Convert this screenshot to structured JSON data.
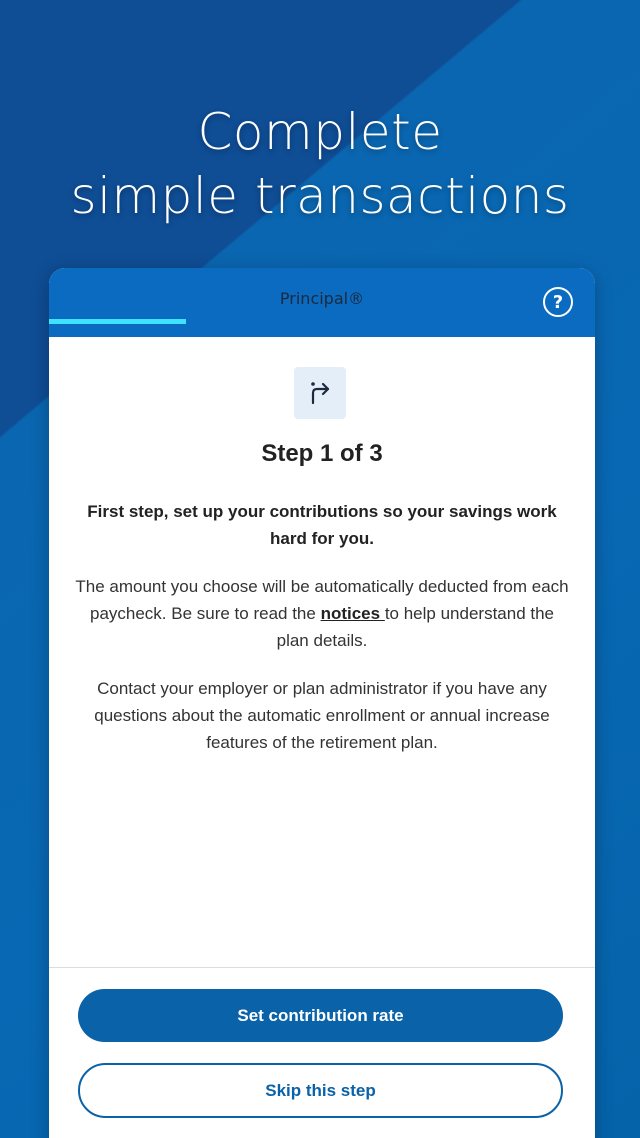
{
  "headline": {
    "line1": "Complete",
    "line2": "simple transactions"
  },
  "header": {
    "title": "Principal®",
    "help_icon": "help-circle-icon",
    "progress_fraction": 0.25
  },
  "step": {
    "icon": "turn-right-arrow-icon",
    "title": "Step 1 of 3",
    "lead": "First step, set up your contributions so your savings work hard for you.",
    "para1_before": "The amount you choose will be automatically deducted from each paycheck. Be sure to read the ",
    "para1_link": "notices ",
    "para1_after": "to help understand the plan details.",
    "para2": "Contact your employer or plan administrator if you have any questions about the automatic enrollment or annual increase features of the retirement plan."
  },
  "actions": {
    "primary_label": "Set contribution rate",
    "secondary_label": "Skip this step"
  },
  "colors": {
    "brand_blue": "#0a62a8",
    "header_blue": "#0a6bc0",
    "progress_accent": "#3fe3ff"
  }
}
